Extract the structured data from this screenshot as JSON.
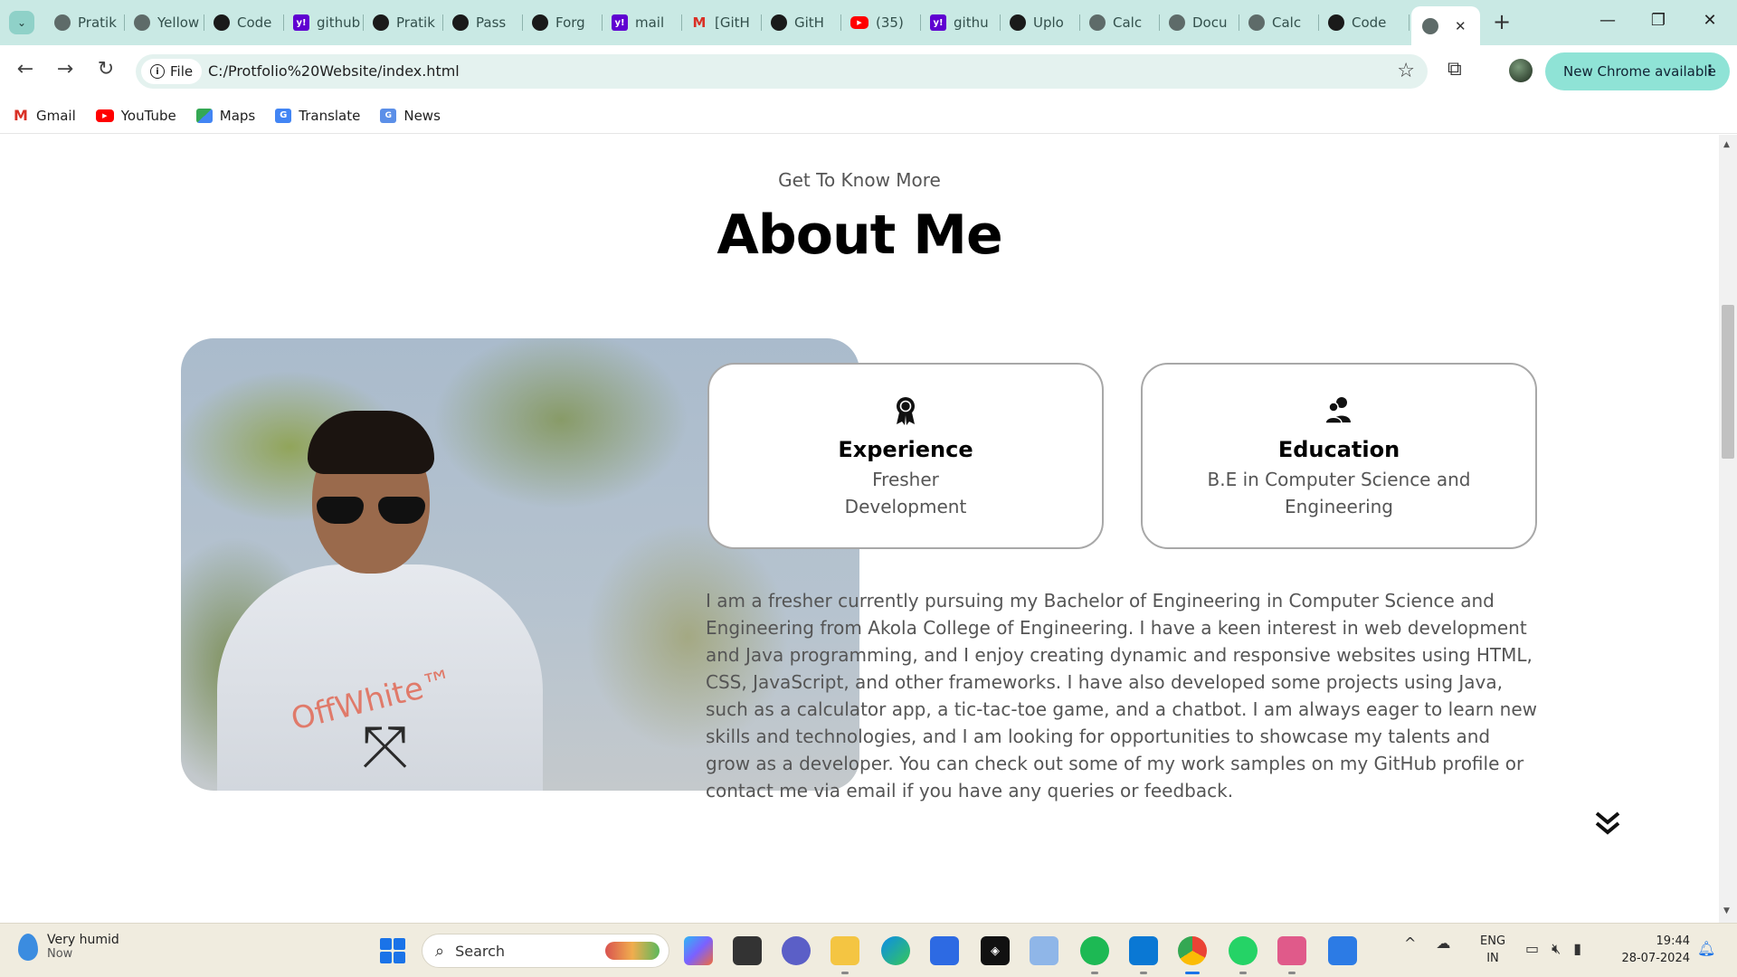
{
  "browser": {
    "tabs": [
      {
        "title": "Pratik",
        "icon": "globe-icon"
      },
      {
        "title": "Yellow",
        "icon": "globe-icon"
      },
      {
        "title": "Code",
        "icon": "github-icon"
      },
      {
        "title": "github",
        "icon": "yahoo-icon"
      },
      {
        "title": "Pratik",
        "icon": "github-icon"
      },
      {
        "title": "Pass",
        "icon": "github-icon"
      },
      {
        "title": "Forg",
        "icon": "github-icon"
      },
      {
        "title": "mail",
        "icon": "yahoo-icon"
      },
      {
        "title": "[GitH",
        "icon": "gmail-icon"
      },
      {
        "title": "GitH",
        "icon": "github-icon"
      },
      {
        "title": "(35)",
        "icon": "youtube-icon"
      },
      {
        "title": "githu",
        "icon": "yahoo-icon"
      },
      {
        "title": "Uplo",
        "icon": "github-icon"
      },
      {
        "title": "Calc",
        "icon": "globe-icon"
      },
      {
        "title": "Docu",
        "icon": "globe-icon"
      },
      {
        "title": "Calc",
        "icon": "globe-icon"
      },
      {
        "title": "Code",
        "icon": "github-icon"
      }
    ],
    "address": {
      "scheme_label": "File",
      "url": "C:/Protfolio%20Website/index.html"
    },
    "update_chip": "New Chrome available",
    "bookmarks": [
      "Gmail",
      "YouTube",
      "Maps",
      "Translate",
      "News"
    ]
  },
  "page": {
    "subtitle": "Get To Know More",
    "title": "About Me",
    "cards": [
      {
        "heading": "Experience",
        "lines": [
          "Fresher",
          "Development"
        ],
        "icon": "award-icon"
      },
      {
        "heading": "Education",
        "lines": [
          "B.E in Computer Science and",
          "Engineering"
        ],
        "icon": "users-icon"
      }
    ],
    "bio": "I am a fresher currently pursuing my Bachelor of Engineering in Computer Science and Engineering from Akola College of Engineering. I have a keen interest in web development and Java programming, and I enjoy creating dynamic and responsive websites using HTML, CSS, JavaScript, and other frameworks. I have also developed some projects using Java, such as a calculator app, a tic-tac-toe game, and a chatbot. I am always eager to learn new skills and technologies, and I am looking for opportunities to showcase my talents and grow as a developer. You can check out some of my work samples on my GitHub profile or contact me via email if you have any queries or feedback.",
    "photo_hoodie_text": "OffWhite™"
  },
  "taskbar": {
    "weather_title": "Very humid",
    "weather_sub": "Now",
    "search_placeholder": "Search",
    "lang_top": "ENG",
    "lang_bottom": "IN",
    "time": "19:44",
    "date": "28-07-2024"
  },
  "colors": {
    "tabstrip": "#c9e9e4",
    "omnibox": "#e4f2ef",
    "update_chip": "#8fe3d6",
    "taskbar": "#f0ecdf"
  }
}
